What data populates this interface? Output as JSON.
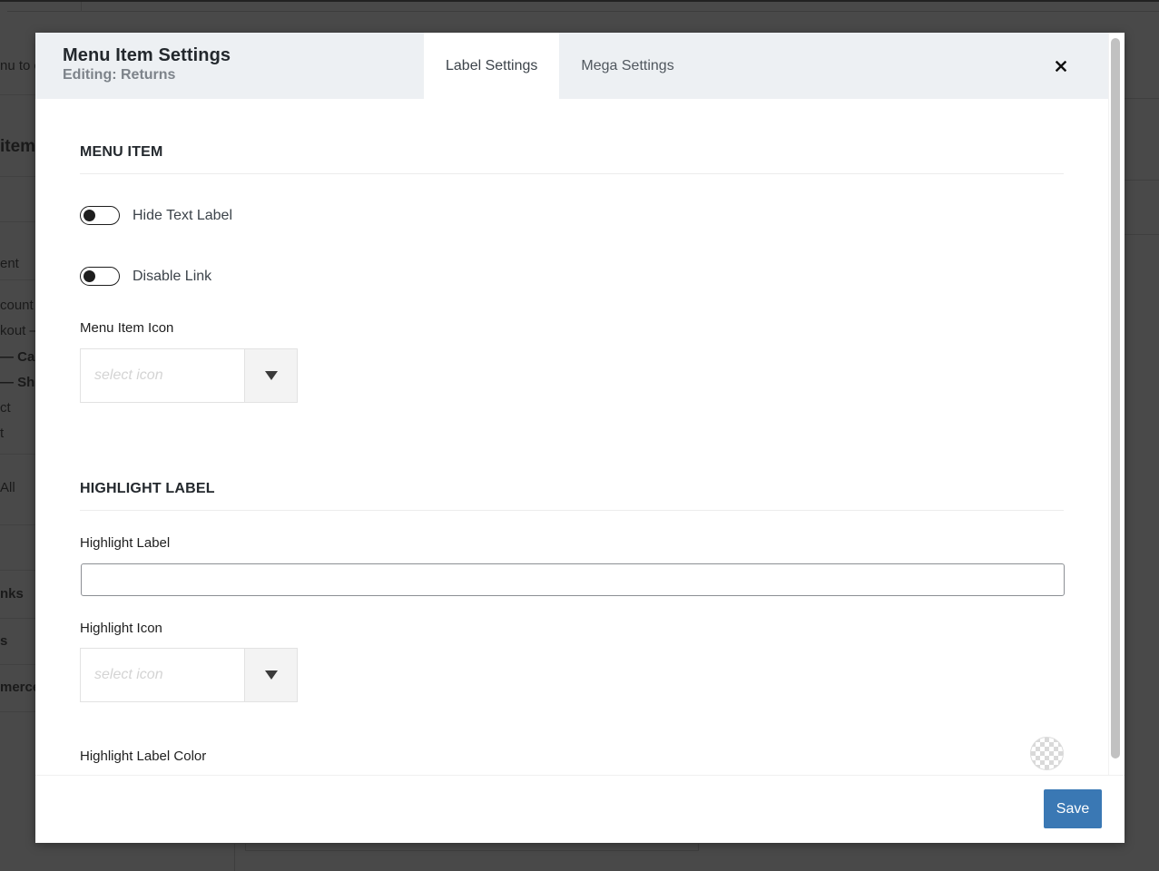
{
  "background": {
    "snippets": [
      {
        "text": "nu to c",
        "style": "normal"
      },
      {
        "text": "item",
        "style": "big"
      },
      {
        "text": "ent",
        "style": "normal"
      },
      {
        "text": "count",
        "style": "normal"
      },
      {
        "text": "kout –",
        "style": "normal"
      },
      {
        "text": "— Car",
        "style": "bold"
      },
      {
        "text": "— Sh",
        "style": "bold"
      },
      {
        "text": "ct",
        "style": "normal"
      },
      {
        "text": "t",
        "style": "normal"
      },
      {
        "text": "All",
        "style": "normal"
      },
      {
        "text": "nks",
        "style": "bold"
      },
      {
        "text": "s",
        "style": "bold"
      },
      {
        "text": "merce",
        "style": "bold"
      }
    ]
  },
  "modal": {
    "title": "Menu Item Settings",
    "subtitle": "Editing: Returns",
    "tabs": [
      {
        "label": "Label Settings",
        "active": true
      },
      {
        "label": "Mega Settings",
        "active": false
      }
    ],
    "close_icon": "close-icon",
    "sections": {
      "menu_item": {
        "title": "MENU ITEM",
        "toggles": [
          {
            "label": "Hide Text Label",
            "on": false
          },
          {
            "label": "Disable Link",
            "on": false
          }
        ],
        "icon_field": {
          "label": "Menu Item Icon",
          "placeholder": "select icon",
          "value": ""
        }
      },
      "highlight_label": {
        "title": "HIGHLIGHT LABEL",
        "label_field": {
          "label": "Highlight Label",
          "value": "",
          "placeholder": ""
        },
        "icon_field": {
          "label": "Highlight Icon",
          "placeholder": "select icon",
          "value": ""
        },
        "color_field": {
          "label": "Highlight Label Color",
          "value": "transparent"
        }
      }
    },
    "footer": {
      "save_label": "Save"
    },
    "colors": {
      "header_bg": "#edf0f3",
      "save_button": "#3a78b4",
      "overlay": "#494949"
    }
  }
}
